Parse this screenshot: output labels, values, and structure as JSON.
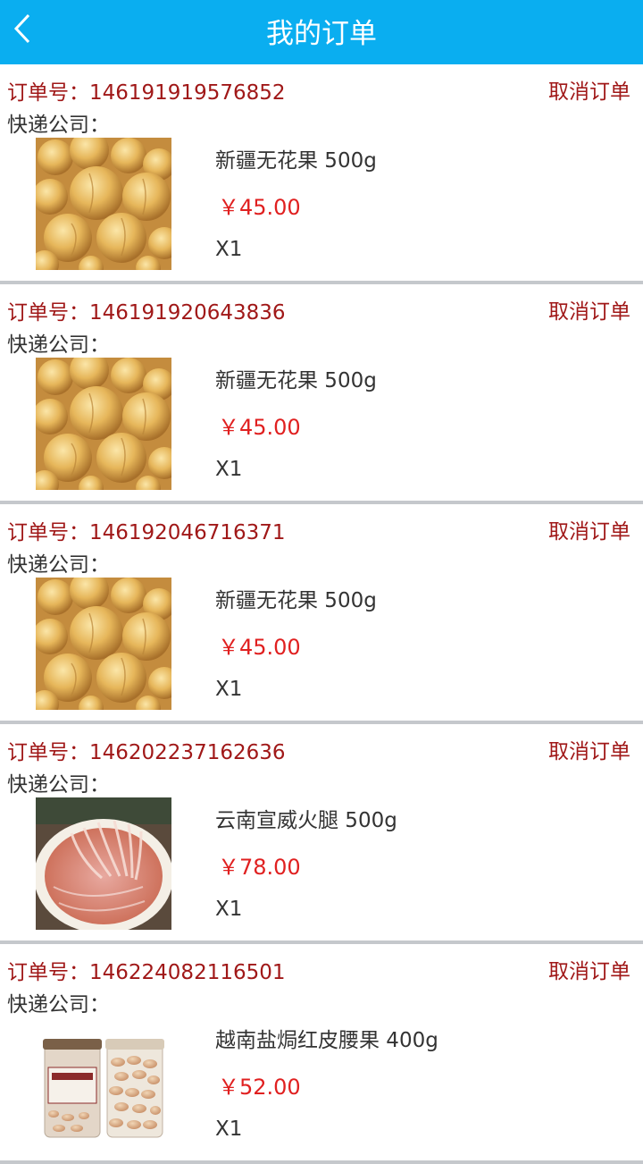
{
  "header": {
    "title": "我的订单",
    "back_icon": "chevron-left-icon",
    "bg_color": "#0aaef0"
  },
  "orders": [
    {
      "order_no": "订单号：146191919576852",
      "cancel_label": "取消订单",
      "courier": "快递公司：",
      "product_name": "新疆无花果 500g",
      "price": "￥45.00",
      "quantity": "X1",
      "image": "dried-figs-image"
    },
    {
      "order_no": "订单号：146191920643836",
      "cancel_label": "取消订单",
      "courier": "快递公司：",
      "product_name": "新疆无花果 500g",
      "price": "￥45.00",
      "quantity": "X1",
      "image": "dried-figs-image"
    },
    {
      "order_no": "订单号：146192046716371",
      "cancel_label": "取消订单",
      "courier": "快递公司：",
      "product_name": "新疆无花果 500g",
      "price": "￥45.00",
      "quantity": "X1",
      "image": "dried-figs-image"
    },
    {
      "order_no": "订单号：146202237162636",
      "cancel_label": "取消订单",
      "courier": "快递公司：",
      "product_name": "云南宣威火腿 500g",
      "price": "￥78.00",
      "quantity": "X1",
      "image": "sliced-ham-image"
    },
    {
      "order_no": "订单号：146224082116501",
      "cancel_label": "取消订单",
      "courier": "快递公司：",
      "product_name": "越南盐焗红皮腰果 400g",
      "price": "￥52.00",
      "quantity": "X1",
      "image": "cashew-jars-image"
    }
  ],
  "colors": {
    "accent_red": "#a01818",
    "price_red": "#e02020",
    "divider": "#c5c8cc"
  }
}
